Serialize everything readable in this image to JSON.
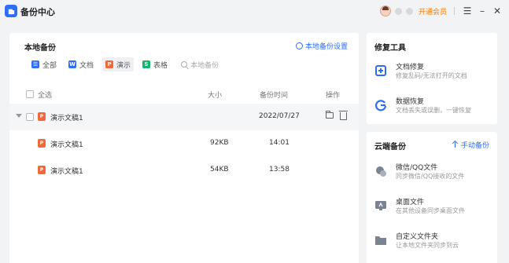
{
  "window": {
    "title": "备份中心",
    "vip_label": "开通会员",
    "menu_glyph": "☰",
    "minimize_glyph": "–",
    "close_glyph": "✕"
  },
  "local": {
    "title": "本地备份",
    "settings_label": "本地备份设置",
    "filters": [
      {
        "label": "全部",
        "icon": "all-icon",
        "badge": "☰"
      },
      {
        "label": "文档",
        "icon": "word-icon",
        "badge": "W"
      },
      {
        "label": "演示",
        "icon": "ppt-icon",
        "badge": "P"
      },
      {
        "label": "表格",
        "icon": "excel-icon",
        "badge": "S"
      }
    ],
    "active_filter": "演示",
    "search_placeholder": "本地备份",
    "columns": {
      "select_all": "全选",
      "size": "大小",
      "time": "备份时间",
      "ops": "操作"
    },
    "group": {
      "name": "演示文稿1",
      "date": "2022/07/27",
      "icon_badge": "P"
    },
    "files": [
      {
        "name": "演示文稿1",
        "size": "92KB",
        "time": "14:01",
        "icon_badge": "P"
      },
      {
        "name": "演示文稿1",
        "size": "54KB",
        "time": "13:58",
        "icon_badge": "P"
      }
    ]
  },
  "tools": {
    "title": "修复工具",
    "items": [
      {
        "title": "文档修复",
        "desc": "修复乱码/无法打开的文档",
        "icon": "doc-repair-icon"
      },
      {
        "title": "数据恢复",
        "desc": "文档丢失或误删，一键恢复",
        "icon": "data-recovery-icon"
      }
    ]
  },
  "cloud": {
    "title": "云端备份",
    "manual_label": "手动备份",
    "items": [
      {
        "title": "微信/QQ文件",
        "desc": "同步微信/QQ接收的文件",
        "icon": "chat-files-icon"
      },
      {
        "title": "桌面文件",
        "desc": "在其他设备同步桌面文件",
        "icon": "desktop-icon"
      },
      {
        "title": "自定义文件夹",
        "desc": "让本地文件夹同步到云",
        "icon": "folder-icon"
      }
    ]
  },
  "colors": {
    "accent": "#2f6df6",
    "vip": "#ff7a00",
    "ppt": "#f0693b",
    "excel": "#17b26a"
  }
}
